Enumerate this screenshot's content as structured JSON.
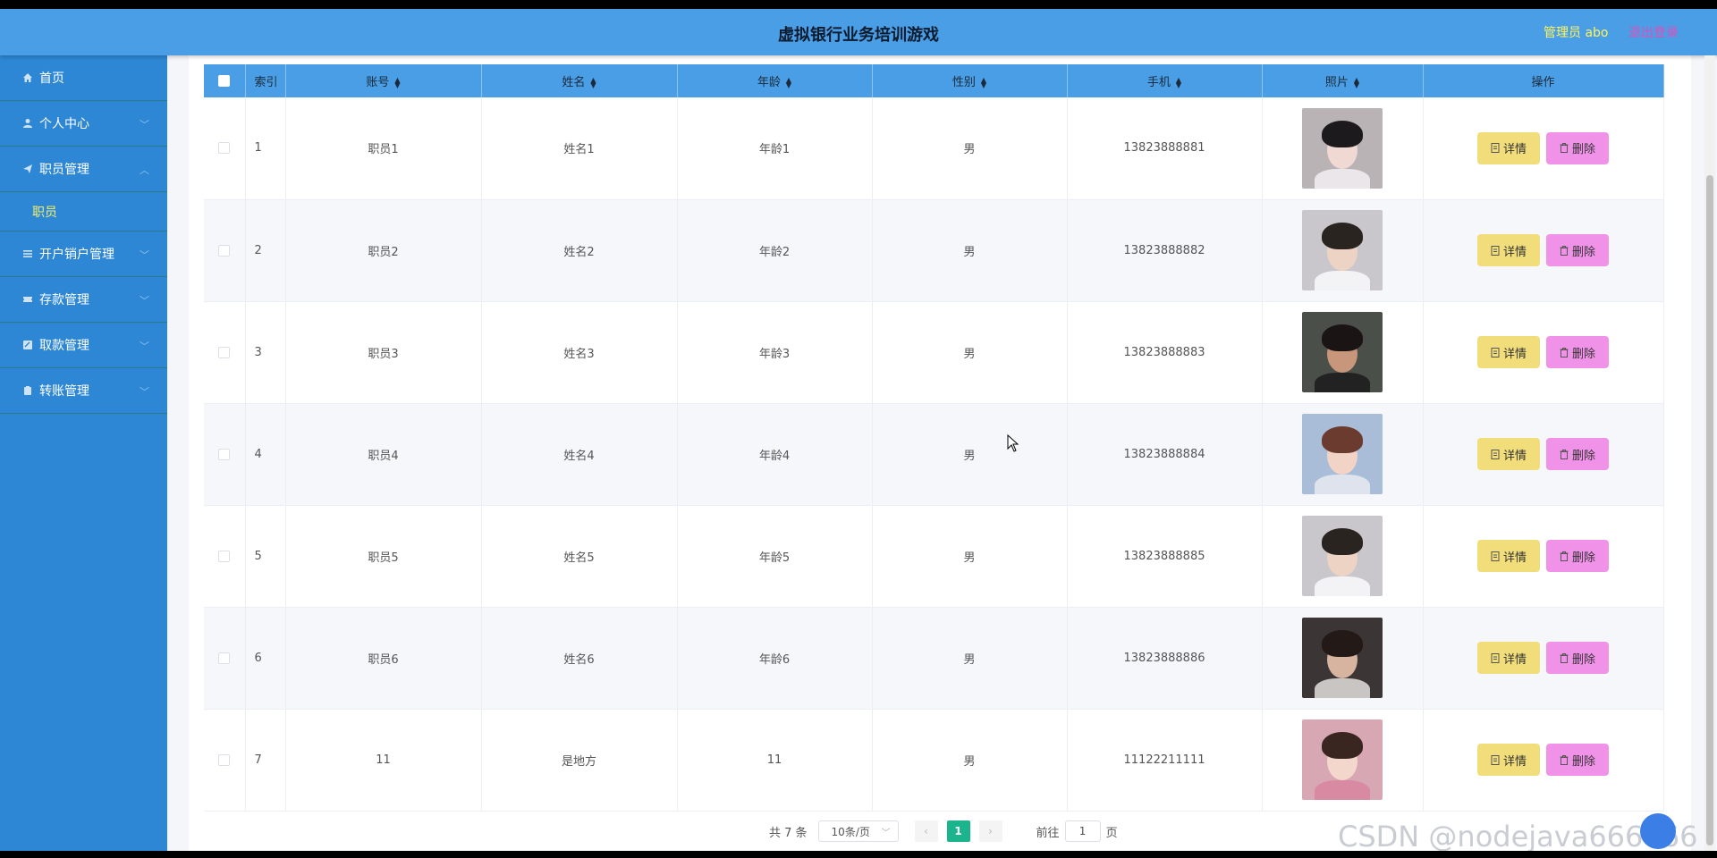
{
  "header": {
    "title": "虚拟银行业务培训游戏",
    "admin_label": "管理员 abo",
    "logout_label": "退出登录"
  },
  "sidebar": {
    "items": [
      {
        "label": "首页",
        "icon": "home-icon"
      },
      {
        "label": "个人中心",
        "icon": "user-icon"
      },
      {
        "label": "职员管理",
        "icon": "send-icon"
      },
      {
        "label": "开户销户管理",
        "icon": "list-icon"
      },
      {
        "label": "存款管理",
        "icon": "ticket-icon"
      },
      {
        "label": "取款管理",
        "icon": "edit-icon"
      },
      {
        "label": "转账管理",
        "icon": "clipboard-icon"
      }
    ],
    "sub_item": "职员"
  },
  "table": {
    "headers": [
      "索引",
      "账号",
      "姓名",
      "年龄",
      "性别",
      "手机",
      "照片",
      "操作"
    ],
    "rows": [
      {
        "index": "1",
        "account": "职员1",
        "name": "姓名1",
        "age": "年龄1",
        "gender": "男",
        "phone": "13823888881"
      },
      {
        "index": "2",
        "account": "职员2",
        "name": "姓名2",
        "age": "年龄2",
        "gender": "男",
        "phone": "13823888882"
      },
      {
        "index": "3",
        "account": "职员3",
        "name": "姓名3",
        "age": "年龄3",
        "gender": "男",
        "phone": "13823888883"
      },
      {
        "index": "4",
        "account": "职员4",
        "name": "姓名4",
        "age": "年龄4",
        "gender": "男",
        "phone": "13823888884"
      },
      {
        "index": "5",
        "account": "职员5",
        "name": "姓名5",
        "age": "年龄5",
        "gender": "男",
        "phone": "13823888885"
      },
      {
        "index": "6",
        "account": "职员6",
        "name": "姓名6",
        "age": "年龄6",
        "gender": "男",
        "phone": "13823888886"
      },
      {
        "index": "7",
        "account": "11",
        "name": "是地方",
        "age": "11",
        "gender": "男",
        "phone": "11122211111"
      }
    ],
    "detail_label": "详情",
    "delete_label": "删除"
  },
  "pagination": {
    "total": "共 7 条",
    "page_size": "10条/页",
    "current_page": "1",
    "goto_label": "前往",
    "goto_value": "1",
    "page_suffix": "页"
  },
  "watermark": "CSDN @nodejava666666",
  "colors": {
    "header_bg": "#4a9ee6",
    "sidebar_bg": "#2e87d4",
    "detail_btn": "#f1dd7a",
    "delete_btn": "#f092e8",
    "active_page": "#1cb48c"
  }
}
